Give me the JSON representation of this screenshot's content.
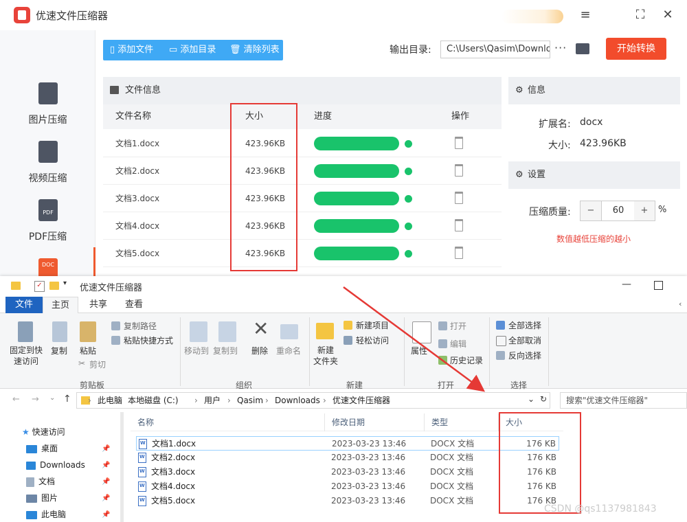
{
  "app": {
    "title": "优速文件压缩器",
    "sidebar": [
      {
        "label": "图片压缩",
        "icon": "image-file-icon"
      },
      {
        "label": "视频压缩",
        "icon": "video-file-icon"
      },
      {
        "label": "PDF压缩",
        "icon": "pdf-file-icon",
        "icon_text": "PDF"
      },
      {
        "label": "",
        "icon": "doc-file-icon",
        "icon_text": "DOC"
      }
    ],
    "toolbar": {
      "add_file": "添加文件",
      "add_dir": "添加目录",
      "clear_list": "清除列表"
    },
    "output": {
      "label": "输出目录:",
      "path": "C:\\Users\\Qasim\\Downlo",
      "more": "···"
    },
    "start_button": "开始转换",
    "file_panel": {
      "title": "文件信息",
      "columns": {
        "name": "文件名称",
        "size": "大小",
        "progress": "进度",
        "action": "操作"
      },
      "rows": [
        {
          "name": "文档1.docx",
          "size": "423.96KB",
          "progress": 1.0
        },
        {
          "name": "文档2.docx",
          "size": "423.96KB",
          "progress": 1.0
        },
        {
          "name": "文档3.docx",
          "size": "423.96KB",
          "progress": 1.0
        },
        {
          "name": "文档4.docx",
          "size": "423.96KB",
          "progress": 1.0
        },
        {
          "name": "文档5.docx",
          "size": "423.96KB",
          "progress": 1.0
        }
      ]
    },
    "info_panel": {
      "title": "信息",
      "ext_label": "扩展名:",
      "ext_value": "docx",
      "size_label": "大小:",
      "size_value": "423.96KB"
    },
    "settings_panel": {
      "title": "设置",
      "quality_label": "压缩质量:",
      "minus": "−",
      "value": "60",
      "plus": "+",
      "unit": "%",
      "hint": "数值越低压缩的越小"
    },
    "colors": {
      "accent_blue": "#3fa9f5",
      "start_red": "#f24c2c",
      "progress_green": "#19c36b",
      "hint_red": "#e8433a"
    }
  },
  "explorer": {
    "title": "优速文件压缩器",
    "tabs": {
      "file": "文件",
      "home": "主页",
      "share": "共享",
      "view": "查看"
    },
    "ribbon": {
      "pin_quick": "固定到快\n速访问",
      "copy": "复制",
      "paste": "粘贴",
      "copy_path": "复制路径",
      "paste_shortcut": "粘贴快捷方式",
      "cut": "剪切",
      "group_clipboard": "剪贴板",
      "move_to": "移动到",
      "copy_to": "复制到",
      "delete": "删除",
      "rename": "重命名",
      "group_organize": "组织",
      "new_folder": "新建\n文件夹",
      "new_item": "新建项目",
      "easy_access": "轻松访问",
      "group_new": "新建",
      "properties": "属性",
      "open": "打开",
      "edit": "编辑",
      "history": "历史记录",
      "group_open": "打开",
      "select_all": "全部选择",
      "select_none": "全部取消",
      "invert": "反向选择",
      "group_select": "选择"
    },
    "breadcrumb": [
      "此电脑",
      "本地磁盘 (C:)",
      "用户",
      "Qasim",
      "Downloads",
      "优速文件压缩器"
    ],
    "search_placeholder": "搜索\"优速文件压缩器\"",
    "nav": [
      {
        "label": "快速访问",
        "pinned": false
      },
      {
        "label": "桌面",
        "pinned": true
      },
      {
        "label": "Downloads",
        "pinned": true
      },
      {
        "label": "文档",
        "pinned": true
      },
      {
        "label": "图片",
        "pinned": true
      },
      {
        "label": "此电脑",
        "pinned": true
      }
    ],
    "columns": {
      "name": "名称",
      "date": "修改日期",
      "type": "类型",
      "size": "大小"
    },
    "files": [
      {
        "name": "文档1.docx",
        "date": "2023-03-23 13:46",
        "type": "DOCX 文档",
        "size": "176 KB"
      },
      {
        "name": "文档2.docx",
        "date": "2023-03-23 13:46",
        "type": "DOCX 文档",
        "size": "176 KB"
      },
      {
        "name": "文档3.docx",
        "date": "2023-03-23 13:46",
        "type": "DOCX 文档",
        "size": "176 KB"
      },
      {
        "name": "文档4.docx",
        "date": "2023-03-23 13:46",
        "type": "DOCX 文档",
        "size": "176 KB"
      },
      {
        "name": "文档5.docx",
        "date": "2023-03-23 13:46",
        "type": "DOCX 文档",
        "size": "176 KB"
      }
    ]
  },
  "watermark": "CSDN @qs1137981843"
}
